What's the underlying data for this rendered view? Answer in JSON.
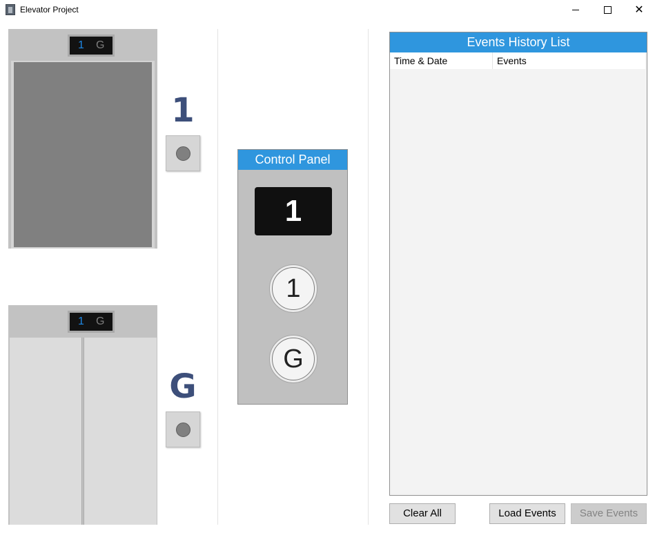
{
  "window": {
    "title": "Elevator Project",
    "icon": "elevator-app-icon",
    "controls": [
      "minimize-icon",
      "maximize-icon",
      "close-icon"
    ]
  },
  "shaft": {
    "top_elevator": {
      "indicator_floor_1": "1",
      "indicator_floor_g": "G",
      "active_floor": "1",
      "doors": "closed"
    },
    "bottom_elevator": {
      "indicator_floor_1": "1",
      "indicator_floor_g": "G",
      "active_floor": "1",
      "doors": "closed-panels"
    }
  },
  "floors": {
    "upper_label": "1",
    "lower_label": "G"
  },
  "control_panel": {
    "title": "Control Panel",
    "display": "1",
    "button_1": "1",
    "button_g": "G"
  },
  "events": {
    "title": "Events History List",
    "columns": [
      "Time & Date",
      "Events"
    ],
    "rows": []
  },
  "buttons": {
    "clear": "Clear All",
    "load": "Load Events",
    "save": "Save Events",
    "save_enabled": false
  },
  "colors": {
    "accent": "#2f96de",
    "floor_label": "#3d4f7a",
    "indicator_active": "#1e88e5",
    "indicator_inactive": "#7e7e7e"
  }
}
